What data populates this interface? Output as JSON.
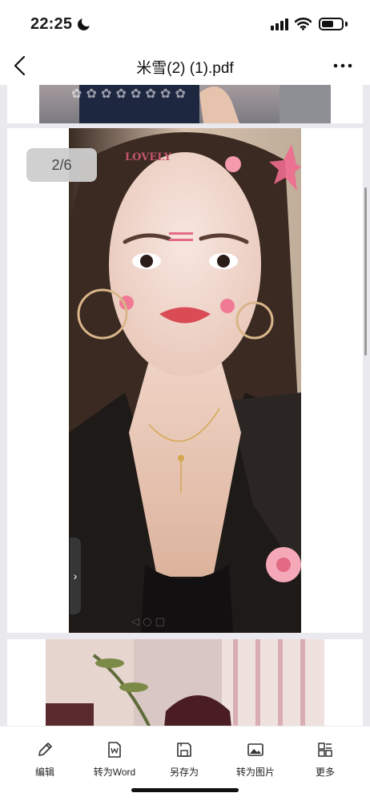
{
  "status_bar": {
    "time": "22:25",
    "icons": [
      "moon-icon",
      "signal-icon",
      "wifi-icon",
      "battery-icon"
    ]
  },
  "nav_bar": {
    "back_icon": "chevron-left-icon",
    "title": "米雪(2) (1).pdf",
    "more_icon": "more-dots-icon"
  },
  "viewer": {
    "page_indicator": "2/6",
    "photo_sticker_text": "LOVELY",
    "side_handle_icon": "chevron-right-icon",
    "background": "#eaeaee"
  },
  "toolbar": {
    "items": [
      {
        "label": "编辑",
        "icon": "pencil-icon"
      },
      {
        "label": "转为Word",
        "icon": "word-doc-icon"
      },
      {
        "label": "另存为",
        "icon": "save-icon"
      },
      {
        "label": "转为图片",
        "icon": "image-icon"
      },
      {
        "label": "更多",
        "icon": "grid-more-icon"
      }
    ]
  }
}
